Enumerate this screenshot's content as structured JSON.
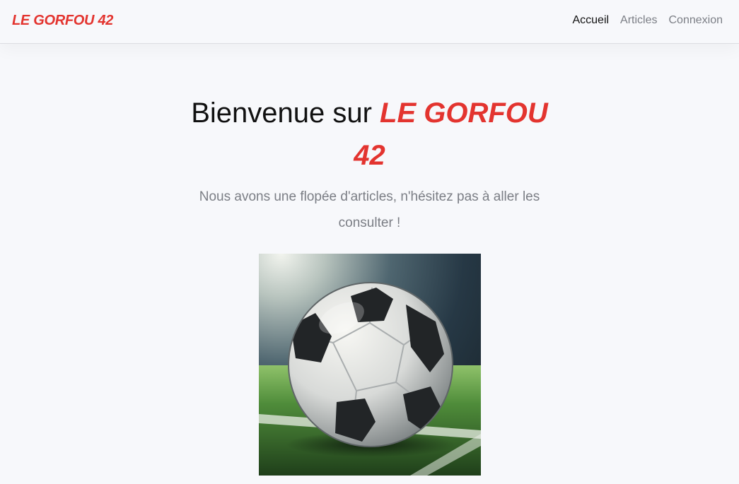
{
  "navbar": {
    "brand": "LE GORFOU 42",
    "links": [
      {
        "label": "Accueil",
        "active": true
      },
      {
        "label": "Articles",
        "active": false
      },
      {
        "label": "Connexion",
        "active": false
      }
    ]
  },
  "hero": {
    "title_prefix": "Bienvenue sur ",
    "title_accent": "LE GORFOU 42",
    "subtitle": "Nous avons une flopée d'articles, n'hésitez pas à aller les consulter !"
  },
  "colors": {
    "accent": "#e3342f",
    "background": "#f7f8fb",
    "muted_text": "#7b7e85"
  }
}
